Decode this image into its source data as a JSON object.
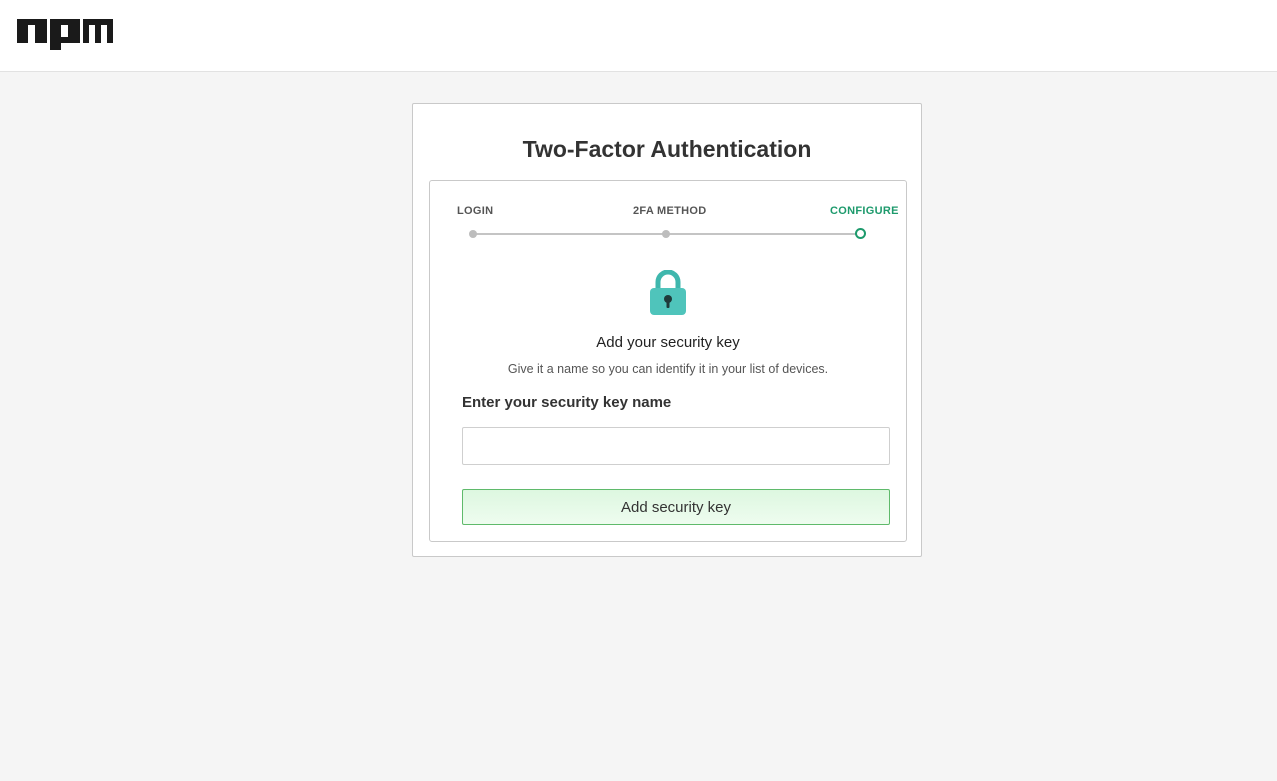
{
  "brand": {
    "logo_text": "npm"
  },
  "page": {
    "title": "Two-Factor Authentication"
  },
  "steps": [
    {
      "label": "LOGIN",
      "state": "done"
    },
    {
      "label": "2FA METHOD",
      "state": "done"
    },
    {
      "label": "CONFIGURE",
      "state": "active"
    }
  ],
  "content": {
    "icon": "lock-icon",
    "heading": "Add your security key",
    "subtext": "Give it a name so you can identify it in your list of devices."
  },
  "form": {
    "label": "Enter your security key name",
    "input_value": "",
    "input_placeholder": "",
    "submit_label": "Add security key"
  },
  "colors": {
    "accent": "#1d9a6c",
    "lock": "#4fc4bb",
    "button_border": "#5fba6b",
    "button_bg": "#e6fae8"
  }
}
